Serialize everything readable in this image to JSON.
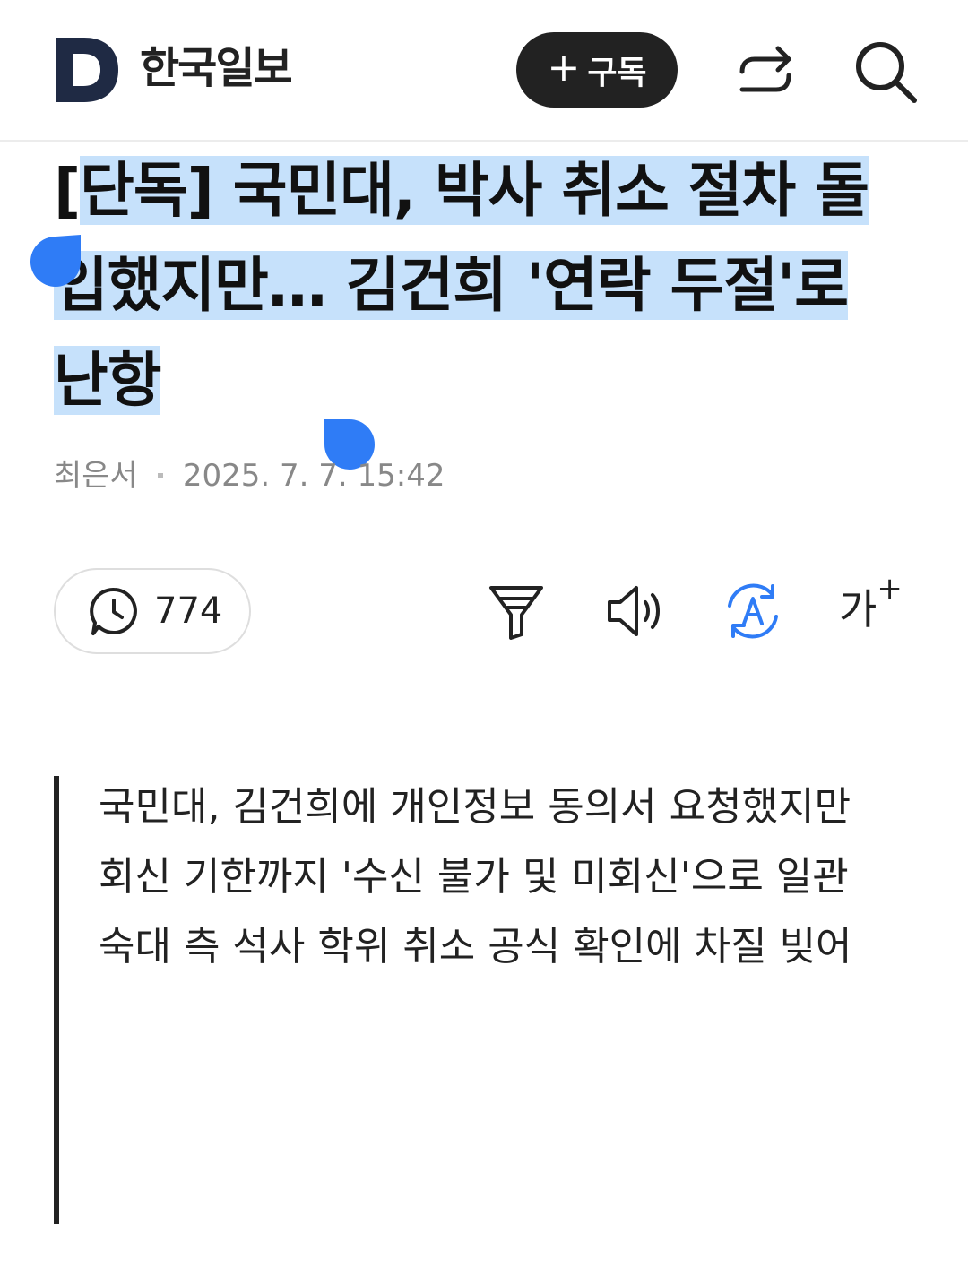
{
  "header": {
    "logo_letter": "D",
    "brand": "한국일보",
    "subscribe_plus": "+",
    "subscribe_label": "구독"
  },
  "article": {
    "headline_prefix": "[",
    "headline_selected": "단독] 국민대, 박사 취소 절차 돌입했지만… 김건희 '연락 두절'로 난항",
    "author": "최은서",
    "date": "2025. 7. 7. 15:42"
  },
  "toolbar": {
    "comment_count": "774",
    "fontsize_label": "가",
    "fontsize_plus": "+"
  },
  "summary": {
    "lines": [
      "국민대, 김건희에 개인정보 동의서 요청했지만",
      "회신 기한까지 '수신 불가 및 미회신'으로 일관",
      "숙대 측 석사 학위 취소 공식 확인에 차질 빚어"
    ]
  },
  "colors": {
    "brand_navy": "#1f2a44",
    "selection_bg": "#c6e1fb",
    "selection_handle": "#2f7cf6",
    "translate_icon": "#2f7cf6"
  },
  "icons": [
    "logo-d-icon",
    "share-icon",
    "search-icon",
    "comment-clock-icon",
    "filter-icon",
    "speaker-icon",
    "translate-icon"
  ]
}
